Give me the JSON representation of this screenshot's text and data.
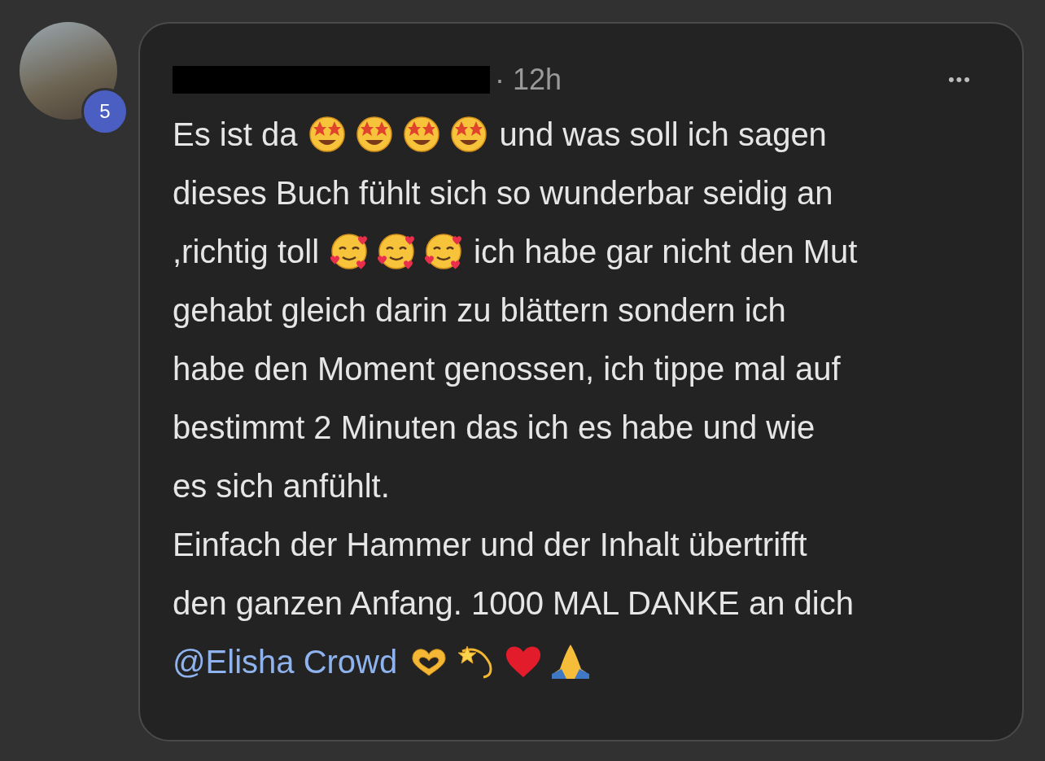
{
  "avatar": {
    "badge": "5"
  },
  "comment": {
    "time": "· 12h",
    "more": "•••",
    "lines": [
      [
        {
          "kind": "text",
          "text": "Es ist da"
        },
        {
          "kind": "starstruck"
        },
        {
          "kind": "starstruck"
        },
        {
          "kind": "starstruck"
        },
        {
          "kind": "starstruck"
        },
        {
          "kind": "text",
          "text": "und was soll ich sagen"
        }
      ],
      [
        {
          "kind": "text",
          "text": "dieses Buch fühlt sich so wunderbar seidig an"
        }
      ],
      [
        {
          "kind": "text",
          "text": ",richtig toll"
        },
        {
          "kind": "hearts_face"
        },
        {
          "kind": "hearts_face"
        },
        {
          "kind": "hearts_face"
        },
        {
          "kind": "text",
          "text": "ich habe gar nicht den Mut"
        }
      ],
      [
        {
          "kind": "text",
          "text": "gehabt gleich darin zu blättern sondern ich"
        }
      ],
      [
        {
          "kind": "text",
          "text": "habe den Moment genossen, ich tippe mal auf"
        }
      ],
      [
        {
          "kind": "text",
          "text": "bestimmt 2 Minuten das ich es habe und wie"
        }
      ],
      [
        {
          "kind": "text",
          "text": "es sich anfühlt."
        }
      ],
      [
        {
          "kind": "text",
          "text": "Einfach der Hammer und der Inhalt übertrifft"
        }
      ],
      [
        {
          "kind": "text",
          "text": "den ganzen Anfang. 1000 MAL DANKE an dich"
        }
      ],
      [
        {
          "kind": "mention",
          "text": "@Elisha Crowd"
        },
        {
          "kind": "heart_hands"
        },
        {
          "kind": "dizzy"
        },
        {
          "kind": "red_heart"
        },
        {
          "kind": "folded_hands"
        }
      ]
    ]
  }
}
